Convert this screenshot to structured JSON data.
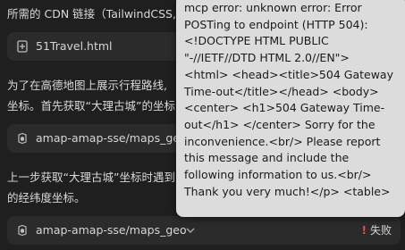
{
  "messages": {
    "line1": "所需的 CDN 链接（TailwindCSS,",
    "file_chip": {
      "icon": "file-icon",
      "label": "51Travel.html"
    },
    "para2_line1": "为了在高德地图上展示行程路线,",
    "para2_line2": "坐标。首先获取“大理古城”的坐标",
    "tool_call_1": {
      "icon": "tool-icon",
      "label": "amap-amap-sse/maps_geo"
    },
    "para3_line1": "上一步获取“大理古城”坐标时遇到",
    "para3_line2": "的经纬度坐标。",
    "tool_call_2": {
      "icon": "tool-icon",
      "label": "amap-amap-sse/maps_geo",
      "status": "失败",
      "status_icon": "!"
    }
  },
  "tooltip": {
    "text": "mcp error: unknown error: Error POSTing to endpoint (HTTP 504): <!DOCTYPE HTML PUBLIC \"-//IETF//DTD HTML 2.0//EN\"> <html> <head><title>504 Gateway Time-out</title></head> <body> <center> <h1>504 Gateway Time-out</h1> </center> Sorry for the inconvenience.<br/> Please report this message and include the following information to us.<br/> Thank you very much!</p> <table>"
  },
  "colors": {
    "background": "#1f1f1f",
    "chip": "#2b2b2b",
    "tooltip": "#dcdcdc",
    "error": "#f04a4a"
  }
}
